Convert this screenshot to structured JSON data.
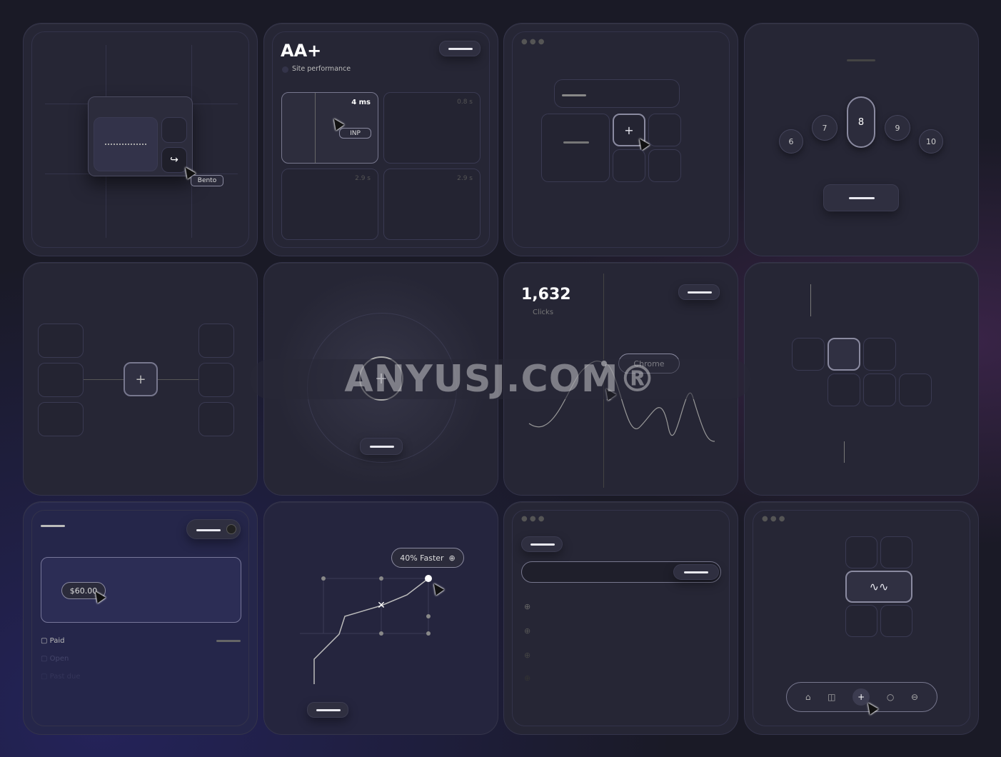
{
  "folder_card": {
    "tag": "Bento"
  },
  "performance_card": {
    "grade": "AA+",
    "subtitle": "Site performance",
    "metrics": [
      {
        "value": "4 ms",
        "badge": "INP"
      },
      {
        "value": "0.8 s"
      },
      {
        "value": "2.9 s"
      },
      {
        "value": "2.9 s"
      }
    ]
  },
  "dial_card": {
    "numbers": [
      "6",
      "7",
      "8",
      "9",
      "10"
    ],
    "selected": "8"
  },
  "clicks_card": {
    "count": "1,632",
    "label": "Clicks",
    "tooltip": "Chrome"
  },
  "invoice_card": {
    "amount": "$60.00",
    "statuses": [
      "Paid",
      "Open",
      "Past due"
    ]
  },
  "route_card": {
    "badge": "40% Faster"
  },
  "dock_card": {
    "icons": [
      "home-icon",
      "sidebar-icon",
      "plus-icon",
      "chat-icon",
      "globe-icon"
    ]
  },
  "watermark": "ANYUSJ.COM®"
}
